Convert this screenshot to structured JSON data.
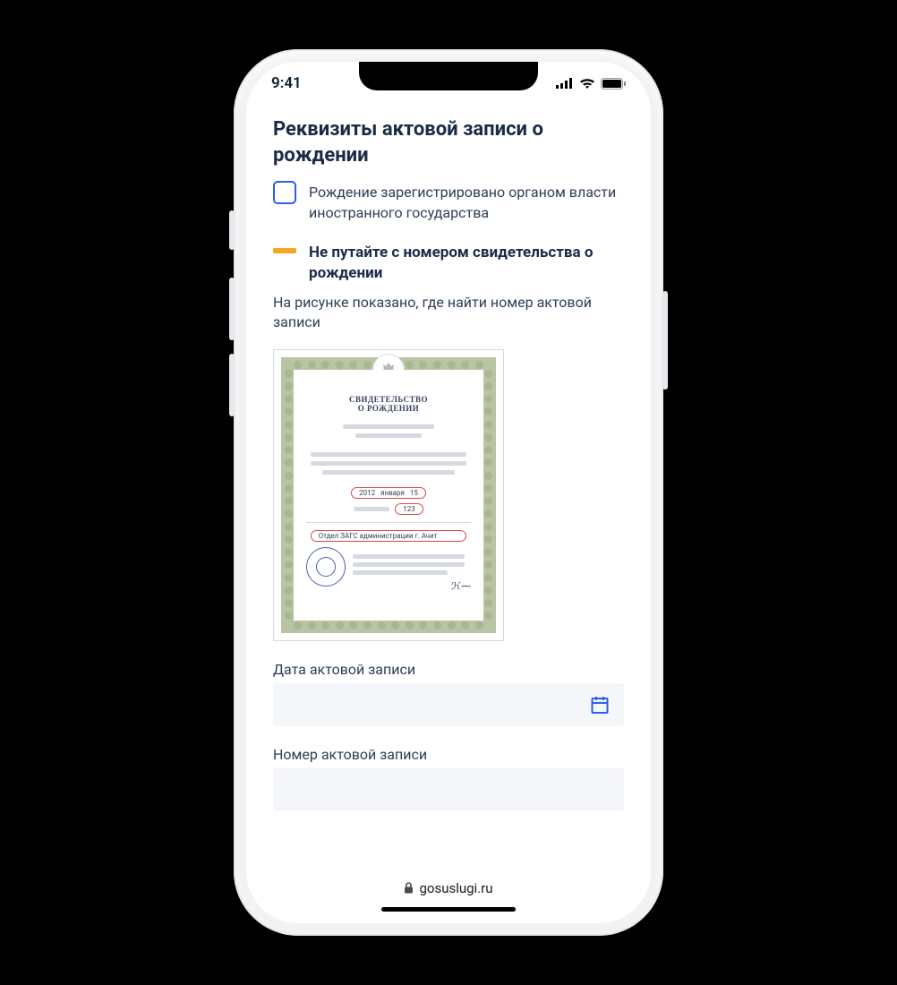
{
  "status": {
    "time": "9:41"
  },
  "page": {
    "title": "Реквизиты актовой записи о рождении",
    "checkbox_label": "Рождение зарегистрировано органом власти иностранного государства",
    "warning_title": "Не путайте с номером свидетельства о рождении",
    "hint": "На рисунке показано, где найти номер актовой записи"
  },
  "certificate": {
    "title_line1": "СВИДЕТЕЛЬСТВО",
    "title_line2": "О РОЖДЕНИИ",
    "date_year": "2012",
    "date_month": "января",
    "date_day": "15",
    "number": "123",
    "issuer": "Отдел ЗАГС администрации г. Ачит"
  },
  "fields": {
    "date_label": "Дата актовой записи",
    "number_label": "Номер актовой записи"
  },
  "browser": {
    "url": "gosuslugi.ru"
  }
}
